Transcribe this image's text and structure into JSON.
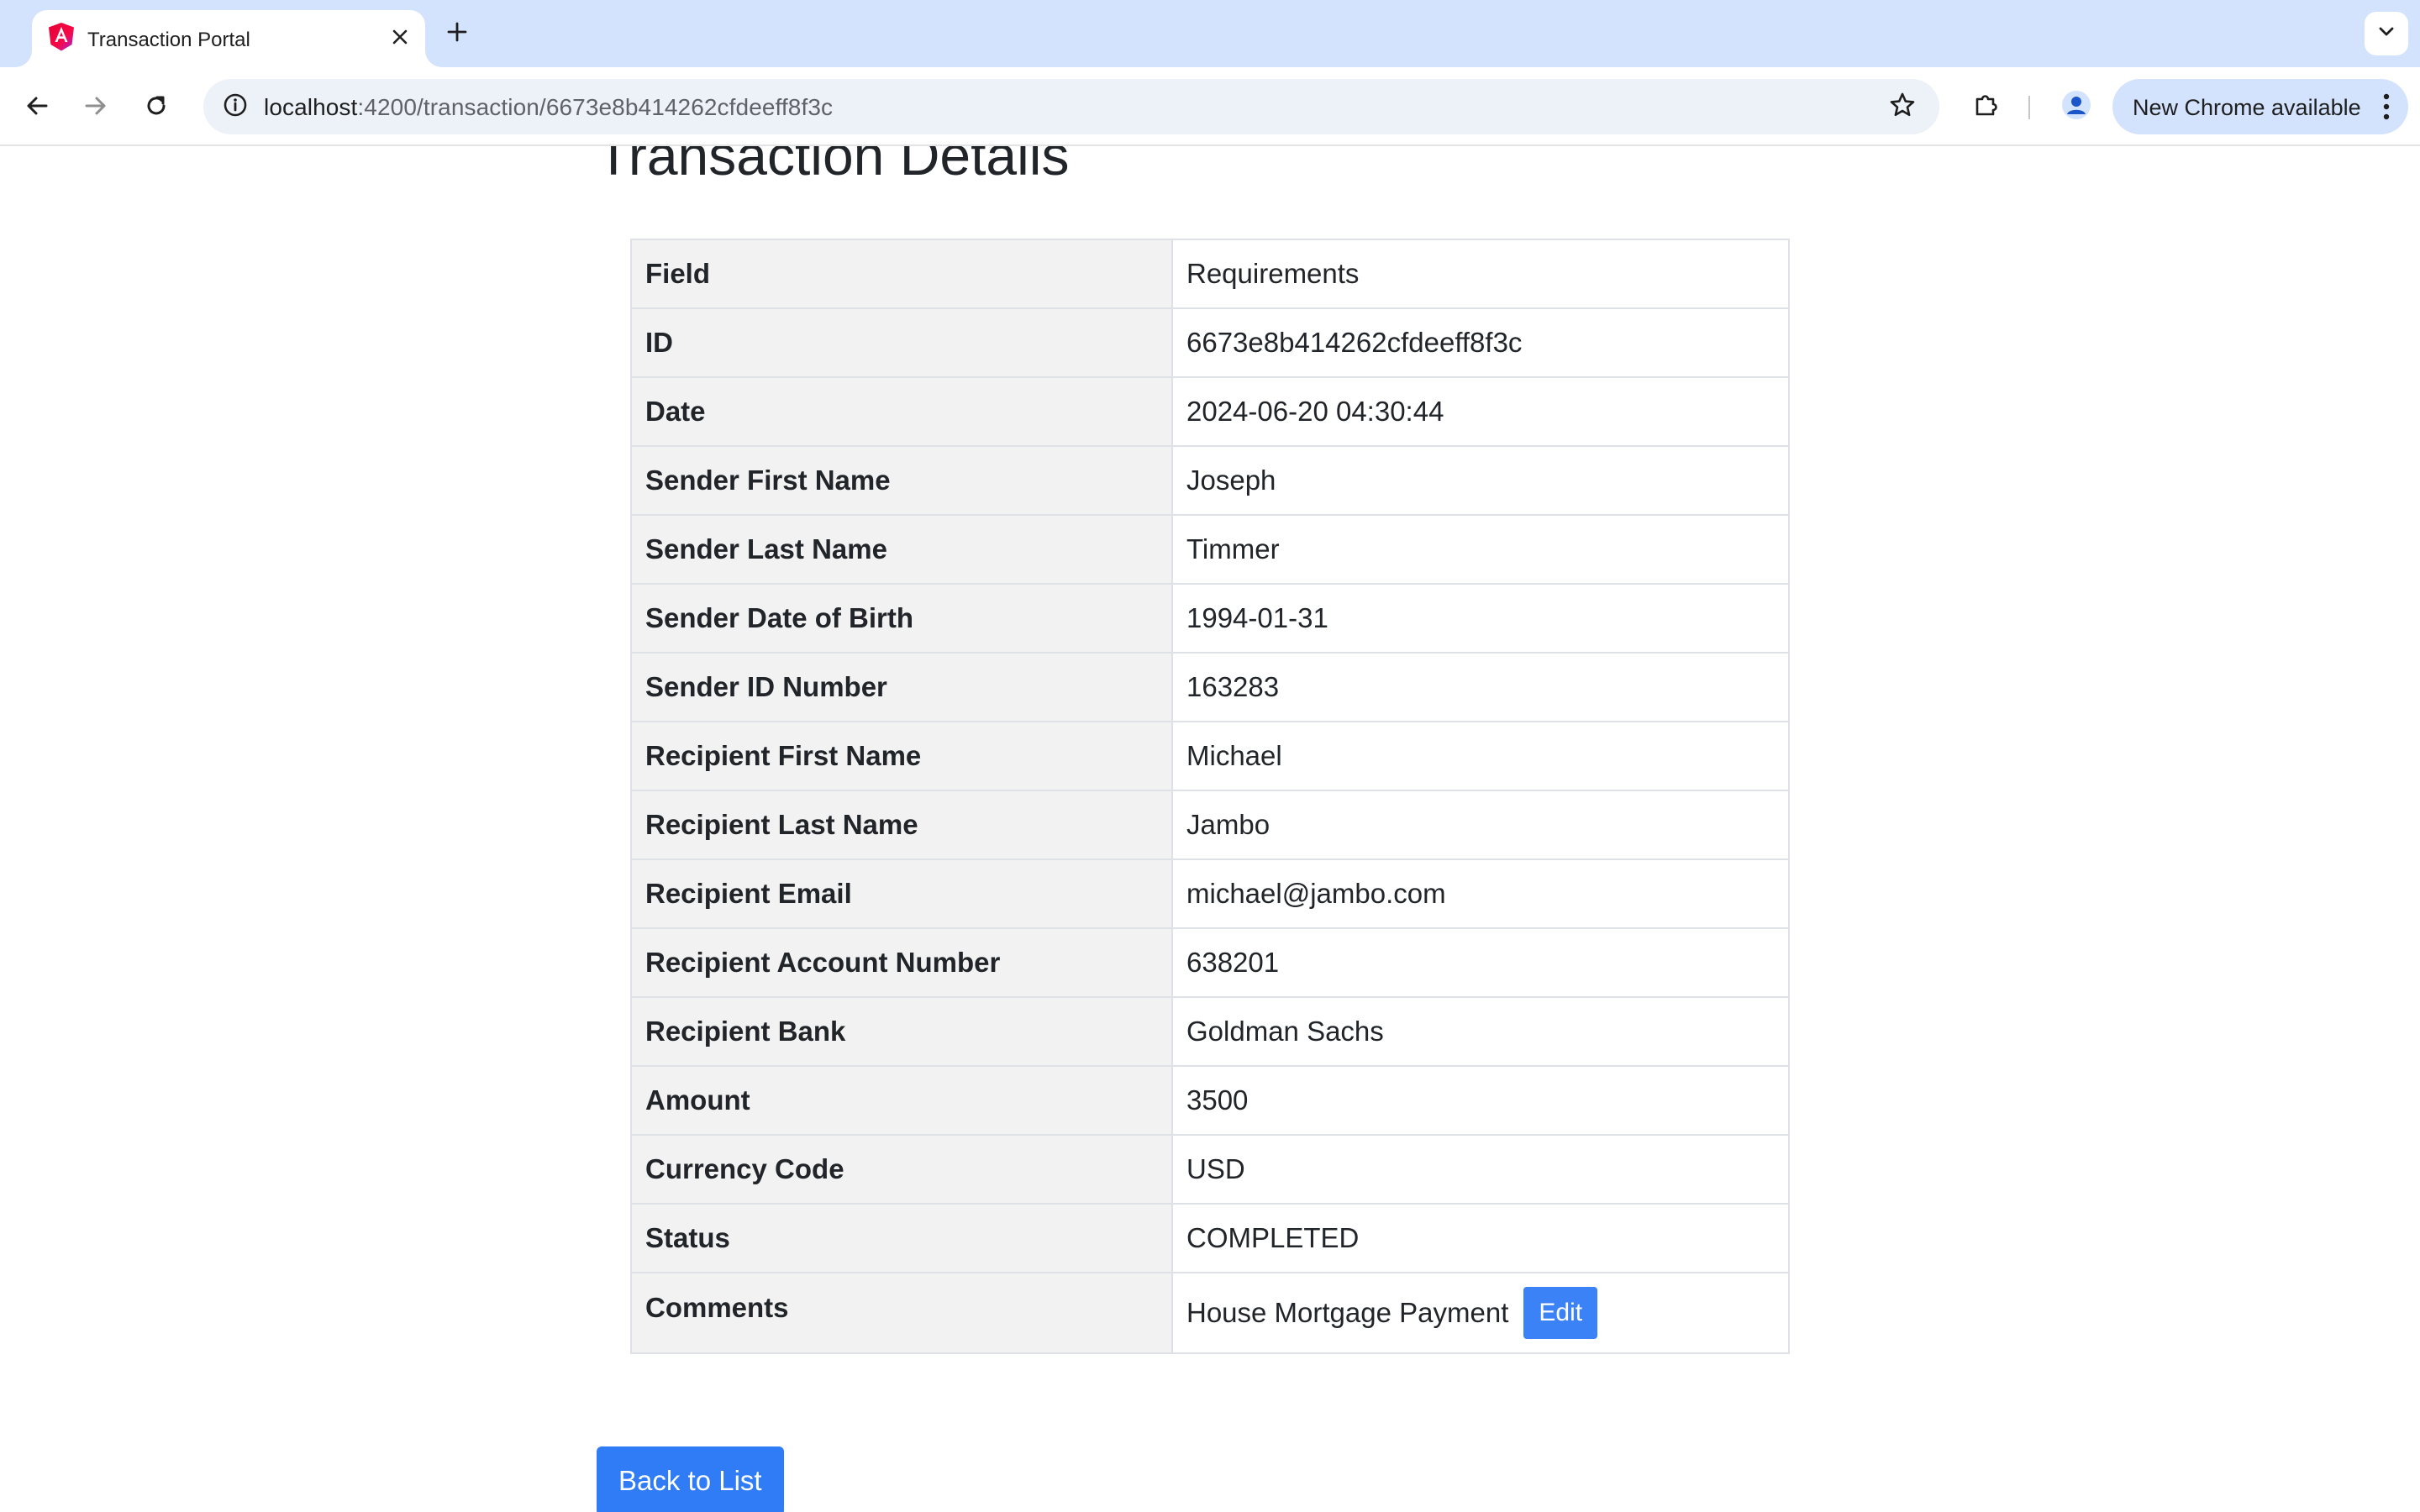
{
  "browser": {
    "tab": {
      "title": "Transaction Portal"
    },
    "url": {
      "host": "localhost",
      "path": ":4200/transaction/6673e8b414262cfdeeff8f3c"
    },
    "update_chip": "New Chrome available"
  },
  "page": {
    "title": "Transaction Details",
    "table": {
      "header": {
        "field": "Field",
        "value": "Requirements"
      },
      "rows": [
        {
          "field": "ID",
          "value": "6673e8b414262cfdeeff8f3c"
        },
        {
          "field": "Date",
          "value": "2024-06-20 04:30:44"
        },
        {
          "field": "Sender First Name",
          "value": "Joseph"
        },
        {
          "field": "Sender Last Name",
          "value": "Timmer"
        },
        {
          "field": "Sender Date of Birth",
          "value": "1994-01-31"
        },
        {
          "field": "Sender ID Number",
          "value": "163283"
        },
        {
          "field": "Recipient First Name",
          "value": "Michael"
        },
        {
          "field": "Recipient Last Name",
          "value": "Jambo"
        },
        {
          "field": "Recipient Email",
          "value": "michael@jambo.com"
        },
        {
          "field": "Recipient Account Number",
          "value": "638201"
        },
        {
          "field": "Recipient Bank",
          "value": "Goldman Sachs"
        },
        {
          "field": "Amount",
          "value": "3500"
        },
        {
          "field": "Currency Code",
          "value": "USD"
        },
        {
          "field": "Status",
          "value": "COMPLETED"
        }
      ],
      "comments": {
        "field": "Comments",
        "value": "House Mortgage Payment",
        "edit_label": "Edit"
      }
    },
    "back_button": "Back to List"
  },
  "colors": {
    "tabstrip": "#d3e3fd",
    "primary_button": "#3b82f6",
    "field_cell": "#f2f2f2",
    "border": "#dee2e6"
  },
  "icons": [
    "angular-favicon-icon",
    "close-icon",
    "plus-icon",
    "chevron-down-icon",
    "back-arrow-icon",
    "forward-arrow-icon",
    "reload-icon",
    "site-info-icon",
    "star-icon",
    "extensions-icon",
    "profile-icon",
    "kebab-menu-icon"
  ]
}
